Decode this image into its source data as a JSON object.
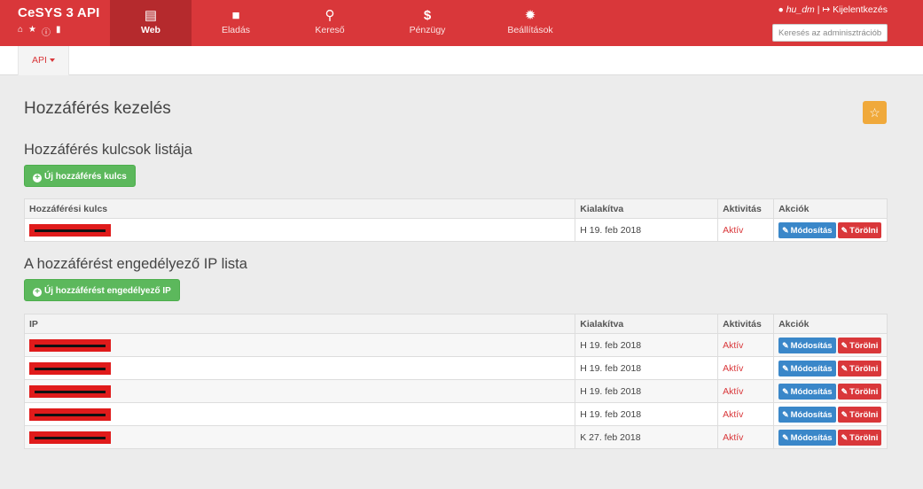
{
  "brand": {
    "title": "CeSYS 3 API"
  },
  "nav": [
    {
      "label": "Web",
      "icon": "web-icon",
      "active": true
    },
    {
      "label": "Eladás",
      "icon": "briefcase-icon"
    },
    {
      "label": "Kereső",
      "icon": "search-icon"
    },
    {
      "label": "Pénzügy",
      "icon": "dollar-icon"
    },
    {
      "label": "Beállítások",
      "icon": "gear-icon"
    }
  ],
  "user": {
    "name": "hu_dm",
    "separator": "|",
    "logout": "Kijelentkezés"
  },
  "admin_search": {
    "placeholder": "Keresés az adminisztrációban"
  },
  "subnav": {
    "api_label": "API"
  },
  "page": {
    "title": "Hozzáférés kezelés"
  },
  "keys_section": {
    "title": "Hozzáférés kulcsok listája",
    "new_button": "Új hozzáférés kulcs",
    "headers": {
      "key": "Hozzáférési kulcs",
      "created": "Kialakítva",
      "activity": "Aktivitás",
      "actions": "Akciók"
    },
    "rows": [
      {
        "created": "H 19. feb 2018",
        "status": "Aktív"
      }
    ]
  },
  "ip_section": {
    "title": "A hozzáférést engedélyező IP lista",
    "new_button": "Új hozzáférést engedélyező IP",
    "headers": {
      "ip": "IP",
      "created": "Kialakítva",
      "activity": "Aktivitás",
      "actions": "Akciók"
    },
    "rows": [
      {
        "created": "H 19. feb 2018",
        "status": "Aktív"
      },
      {
        "created": "H 19. feb 2018",
        "status": "Aktív"
      },
      {
        "created": "H 19. feb 2018",
        "status": "Aktív"
      },
      {
        "created": "H 19. feb 2018",
        "status": "Aktív"
      },
      {
        "created": "K 27. feb 2018",
        "status": "Aktív"
      }
    ]
  },
  "actions": {
    "edit": "Módosítás",
    "delete": "Törölni"
  },
  "colors": {
    "primary": "#d9373a",
    "success": "#5cb85c",
    "info": "#3a87c9",
    "warning": "#f0a93b"
  }
}
